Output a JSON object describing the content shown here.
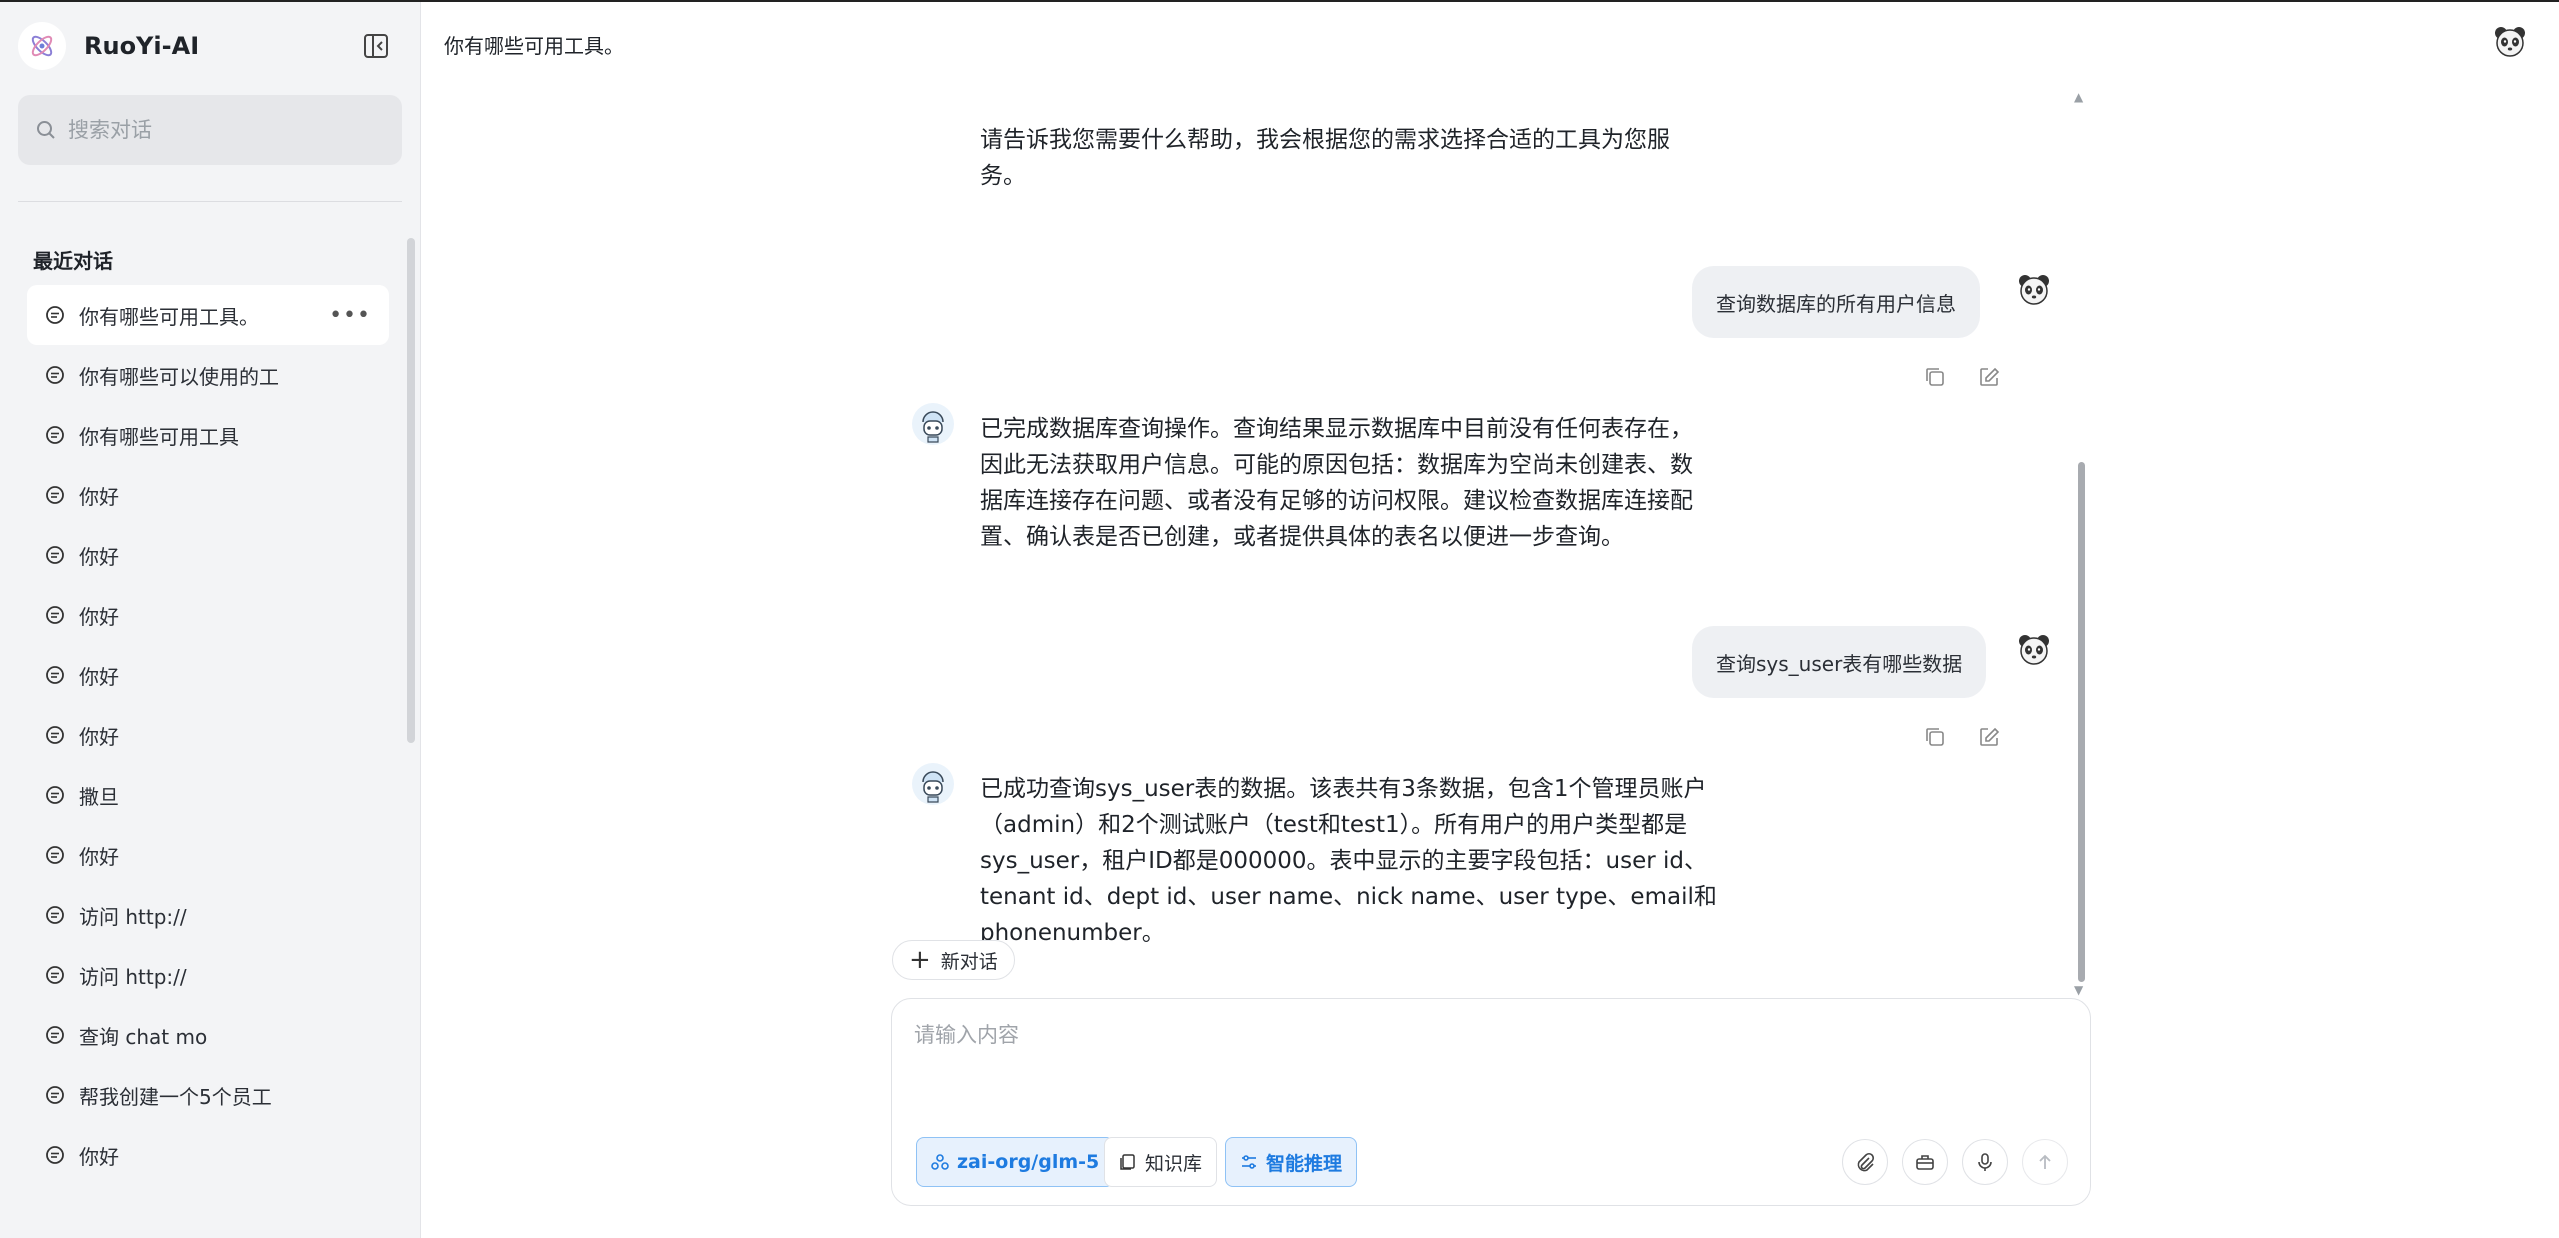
{
  "app": {
    "name": "RuoYi-AI"
  },
  "search": {
    "placeholder": "搜索对话"
  },
  "sidebar": {
    "recent_title": "最近对话",
    "items": [
      {
        "label": "你有哪些可用工具。",
        "active": true
      },
      {
        "label": "你有哪些可以使用的工"
      },
      {
        "label": "你有哪些可用工具"
      },
      {
        "label": "你好"
      },
      {
        "label": "你好"
      },
      {
        "label": "你好"
      },
      {
        "label": "你好"
      },
      {
        "label": "你好"
      },
      {
        "label": "撒旦"
      },
      {
        "label": "你好"
      },
      {
        "label": "访问 http://"
      },
      {
        "label": "访问 http://"
      },
      {
        "label": "查询 chat  mo"
      },
      {
        "label": "帮我创建一个5个员工"
      },
      {
        "label": "你好"
      }
    ],
    "more_label": "•••"
  },
  "header": {
    "title": "你有哪些可用工具。"
  },
  "messages": {
    "m0_line1": "请告诉我您需要什么帮助，我会根据您的需求选择合适的工具为您服",
    "m0_line2": "务。",
    "user1": "查询数据库的所有用户信息",
    "bot1_line1": "已完成数据库查询操作。查询结果显示数据库中目前没有任何表存在，",
    "bot1_line2": "因此无法获取用户信息。可能的原因包括：数据库为空尚未创建表、数",
    "bot1_line3": "据库连接存在问题、或者没有足够的访问权限。建议检查数据库连接配",
    "bot1_line4": "置、确认表是否已创建，或者提供具体的表名以便进一步查询。",
    "user2": "查询sys_user表有哪些数据",
    "bot2_line1": "已成功查询sys_user表的数据。该表共有3条数据，包含1个管理员账户",
    "bot2_line2": "（admin）和2个测试账户（test和test1）。所有用户的用户类型都是",
    "bot2_line3": "sys_user，租户ID都是000000。表中显示的主要字段包括：user id、",
    "bot2_line4": "tenant id、dept id、user name、nick name、user type、email和",
    "bot2_line5": "phonenumber。"
  },
  "composer": {
    "new_chat": "新对话",
    "placeholder": "请输入内容",
    "model": "zai-org/glm-5",
    "knowledge": "知识库",
    "reasoning": "智能推理"
  },
  "colors": {
    "accent": "#1e7be0",
    "accent_bg": "#e7f1fd",
    "sidebar_bg": "#f3f4f6",
    "bubble_bg": "#eef0f3"
  }
}
